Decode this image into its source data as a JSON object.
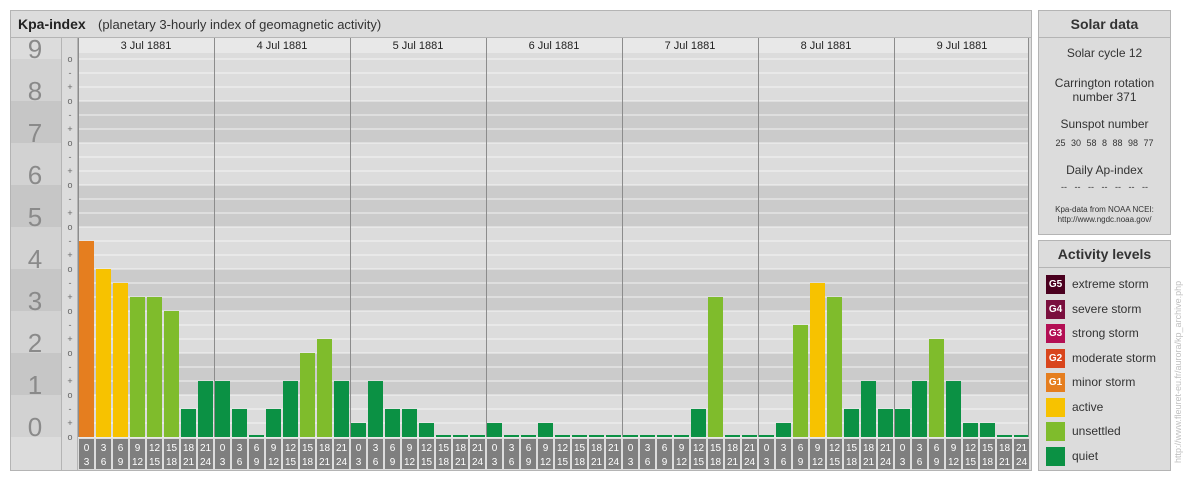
{
  "header": {
    "title": "Kpa-index",
    "subtitle": "(planetary 3-hourly index of geomagnetic activity)"
  },
  "chart_data": {
    "type": "bar",
    "title": "Kpa-index",
    "subtitle": "(planetary 3-hourly index of geomagnetic activity)",
    "ylim": [
      0,
      9
    ],
    "y_ticks": [
      "0",
      "1",
      "2",
      "3",
      "4",
      "5",
      "6",
      "7",
      "8",
      "9"
    ],
    "sub_ticks": [
      "o",
      "+",
      "-"
    ],
    "days": [
      "3 Jul 1881",
      "4 Jul 1881",
      "5 Jul 1881",
      "6 Jul 1881",
      "7 Jul 1881",
      "8 Jul 1881",
      "9 Jul 1881"
    ],
    "time_slots": [
      {
        "top": "0",
        "bottom": "3"
      },
      {
        "top": "3",
        "bottom": "6"
      },
      {
        "top": "6",
        "bottom": "9"
      },
      {
        "top": "9",
        "bottom": "12"
      },
      {
        "top": "12",
        "bottom": "15"
      },
      {
        "top": "15",
        "bottom": "18"
      },
      {
        "top": "18",
        "bottom": "21"
      },
      {
        "top": "21",
        "bottom": "24"
      }
    ],
    "values": [
      [
        4.667,
        4.0,
        3.667,
        3.333,
        3.333,
        3.0,
        0.667,
        1.333
      ],
      [
        1.333,
        0.667,
        0.0,
        0.667,
        1.333,
        2.0,
        2.333,
        1.333
      ],
      [
        0.333,
        1.333,
        0.667,
        0.667,
        0.333,
        0.0,
        0.0,
        0.0
      ],
      [
        0.333,
        0.0,
        0.0,
        0.333,
        0.0,
        0.0,
        0.0,
        0.0
      ],
      [
        0.0,
        0.0,
        0.0,
        0.0,
        0.667,
        3.333,
        0.0,
        0.0
      ],
      [
        0.0,
        0.333,
        2.667,
        3.667,
        3.333,
        0.667,
        1.333,
        0.667
      ],
      [
        0.667,
        1.333,
        2.333,
        1.333,
        0.333,
        0.333,
        0.0,
        0.0
      ]
    ],
    "colors": {
      "quiet": "#0b9144",
      "unsettled": "#7fbc2c",
      "active": "#f7c200",
      "G1": "#e57e1f",
      "G2": "#d9451c",
      "G3": "#b30f54",
      "G4": "#7a0f3e",
      "G5": "#4a001f"
    }
  },
  "solar_data": {
    "title": "Solar data",
    "solar_cycle": "Solar cycle 12",
    "carrington_line1": "Carrington rotation",
    "carrington_line2": "number 371",
    "sunspot_label": "Sunspot number",
    "sunspot_values": "25 30 58 8 88 98 77",
    "ap_label": "Daily Ap-index",
    "ap_values": "-- -- -- -- -- -- --",
    "source_line1": "Kpa-data from NOAA NCEI:",
    "source_line2": "http://www.ngdc.noaa.gov/"
  },
  "activity_levels": {
    "title": "Activity levels",
    "items": [
      {
        "badge": "G5",
        "label": "extreme storm",
        "color": "#4a001f"
      },
      {
        "badge": "G4",
        "label": "severe storm",
        "color": "#7a0f3e"
      },
      {
        "badge": "G3",
        "label": "strong storm",
        "color": "#b30f54"
      },
      {
        "badge": "G2",
        "label": "moderate storm",
        "color": "#d9451c"
      },
      {
        "badge": "G1",
        "label": "minor storm",
        "color": "#e57e1f"
      },
      {
        "badge": "",
        "label": "active",
        "color": "#f7c200"
      },
      {
        "badge": "",
        "label": "unsettled",
        "color": "#7fbc2c"
      },
      {
        "badge": "",
        "label": "quiet",
        "color": "#0b9144"
      }
    ]
  },
  "credit": "http://www.fleuret-eu.fr/aurora/kp_archive.php"
}
